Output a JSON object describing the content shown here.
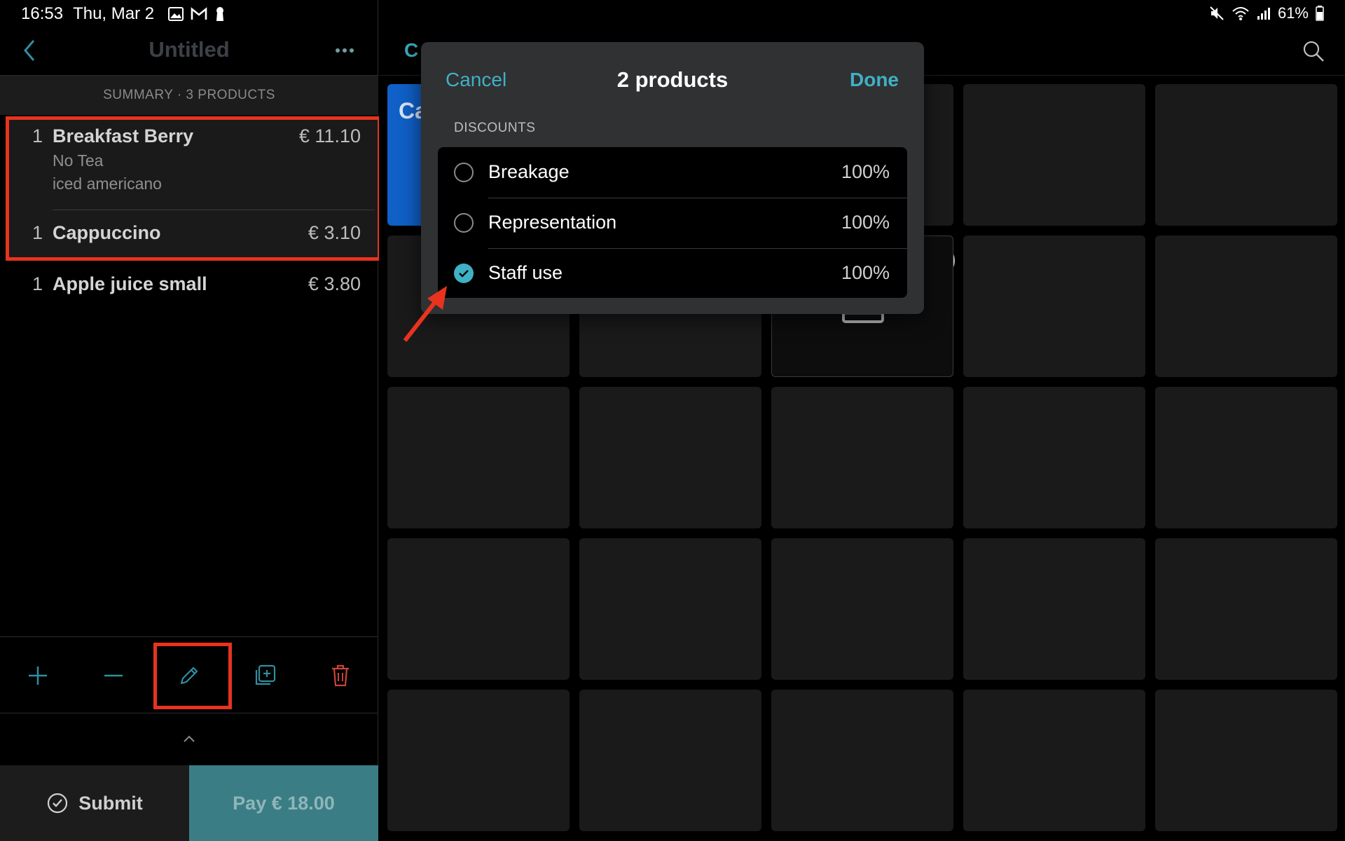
{
  "status_bar": {
    "time": "16:53",
    "date": "Thu, Mar 2",
    "battery": "61%",
    "left_icons": [
      "gallery-icon",
      "gmail-icon",
      "keyhole-icon"
    ],
    "right_icons": [
      "mute-icon",
      "wifi-icon",
      "signal-icon",
      "battery-icon"
    ]
  },
  "order": {
    "title": "Untitled",
    "summary": "SUMMARY · 3 PRODUCTS",
    "items": [
      {
        "qty": "1",
        "name": "Breakfast Berry",
        "price": "€ 11.10",
        "modifiers": [
          "No Tea",
          "iced americano"
        ]
      },
      {
        "qty": "1",
        "name": "Cappuccino",
        "price": "€ 3.10",
        "modifiers": []
      },
      {
        "qty": "1",
        "name": "Apple juice small",
        "price": "€ 3.80",
        "modifiers": []
      }
    ],
    "toolbar_icons": [
      "plus-icon",
      "minus-icon",
      "pencil-icon",
      "duplicate-icon",
      "trash-icon"
    ],
    "submit_label": "Submit",
    "pay_label": "Pay € 18.00"
  },
  "catalog": {
    "tab_partial": "C",
    "tile_partial_label": "Ca",
    "badge_partial": "0"
  },
  "modal": {
    "cancel_label": "Cancel",
    "title": "2 products",
    "done_label": "Done",
    "section_label": "DISCOUNTS",
    "discounts": [
      {
        "name": "Breakage",
        "value": "100%",
        "selected": false
      },
      {
        "name": "Representation",
        "value": "100%",
        "selected": false
      },
      {
        "name": "Staff use",
        "value": "100%",
        "selected": true
      }
    ]
  },
  "colors": {
    "accent": "#3fb1c4",
    "pay_button": "#3a7d85",
    "highlight": "#e8331f",
    "tile": "#1a1a1a",
    "category_tile": "#1060c8",
    "delete": "#c9443a"
  }
}
